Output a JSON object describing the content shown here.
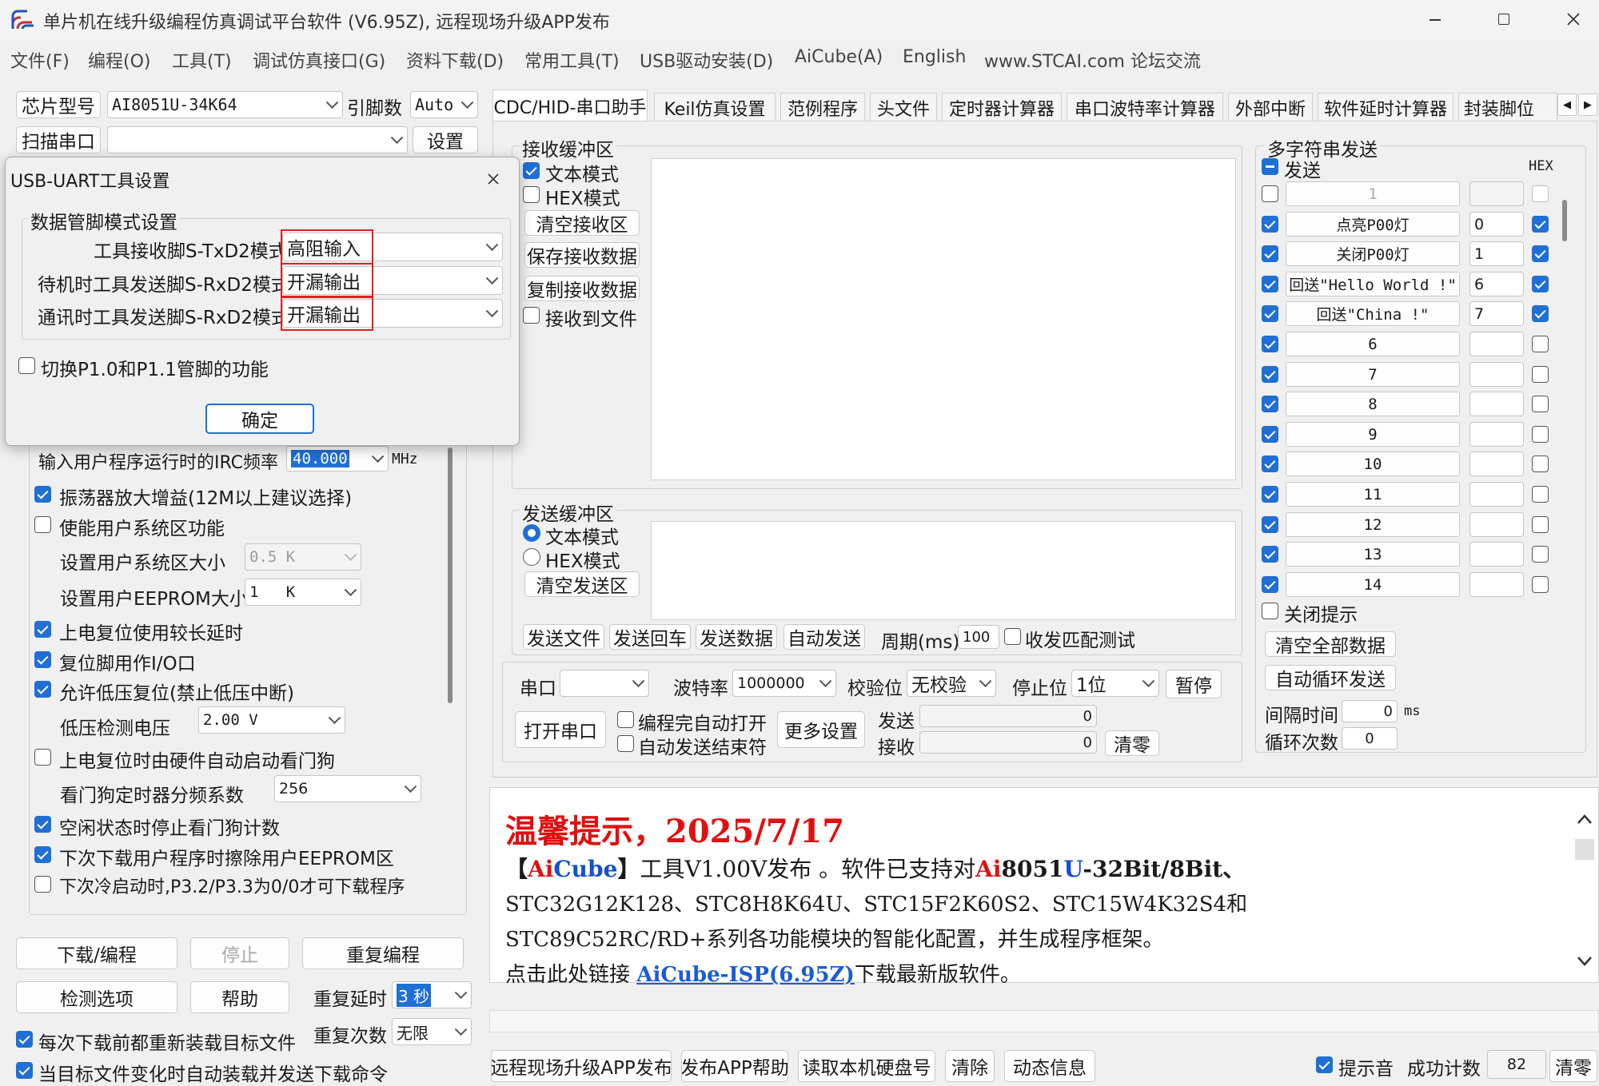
{
  "window": {
    "title": "单片机在线升级编程仿真调试平台软件 (V6.95Z), 远程现场升级APP发布"
  },
  "menu": [
    "文件(F)",
    "编程(O)",
    "工具(T)",
    "调试仿真接口(G)",
    "资料下载(D)",
    "常用工具(T)",
    "USB驱动安装(D)",
    "AiCube(A)",
    "English",
    "www.STCAI.com 论坛交流"
  ],
  "left": {
    "chip_btn": "芯片型号",
    "chip_value": "AI8051U-34K64",
    "pin_label": "引脚数",
    "pin_value": "Auto",
    "scan_btn": "扫描串口",
    "port_value": "",
    "settings_btn": "设置",
    "irc_label": "输入用户程序运行时的IRC频率",
    "irc_value": "40.000",
    "irc_unit": "MHz",
    "options": [
      {
        "label": "振荡器放大增益(12M以上建议选择)",
        "checked": true
      },
      {
        "label": "使能用户系统区功能",
        "checked": false
      },
      {
        "label": "上电复位使用较长延时",
        "checked": true
      },
      {
        "label": "复位脚用作I/O口",
        "checked": true
      },
      {
        "label": "允许低压复位(禁止低压中断)",
        "checked": true
      },
      {
        "label": "上电复位时由硬件自动启动看门狗",
        "checked": false
      },
      {
        "label": "空闲状态时停止看门狗计数",
        "checked": true
      },
      {
        "label": "下次下载用户程序时擦除用户EEPROM区",
        "checked": true
      },
      {
        "label": "下次冷启动时,P3.2/P3.3为0/0才可下载程序",
        "checked": false
      }
    ],
    "sysarea_label": "设置用户系统区大小",
    "sysarea_value": "0.5 K",
    "eeprom_label": "设置用户EEPROM大小",
    "eeprom_value": "1   K",
    "lvd_label": "低压检测电压",
    "lvd_value": "2.00 V",
    "wdt_label": "看门狗定时器分频系数",
    "wdt_value": "256",
    "download_btn": "下载/编程",
    "stop_btn": "停止",
    "reprogram_btn": "重复编程",
    "check_btn": "检测选项",
    "help_btn": "帮助",
    "delay_label": "重复延时",
    "delay_value": "3 秒",
    "count_label": "重复次数",
    "count_value": "无限",
    "reload_label": "每次下载前都重新装载目标文件",
    "autosend_label": "当目标文件变化时自动装载并发送下载命令"
  },
  "dialog": {
    "title": "USB-UART工具设置",
    "group": "数据管脚模式设置",
    "rows": [
      {
        "label": "工具接收脚S-TxD2模式",
        "value": "高阻输入"
      },
      {
        "label": "待机时工具发送脚S-RxD2模式",
        "value": "开漏输出"
      },
      {
        "label": "通讯时工具发送脚S-RxD2模式",
        "value": "开漏输出"
      }
    ],
    "switch_label": "切换P1.0和P1.1管脚的功能",
    "ok": "确定"
  },
  "tabs": [
    "CDC/HID-串口助手",
    "Keil仿真设置",
    "范例程序",
    "头文件",
    "定时器计算器",
    "串口波特率计算器",
    "外部中断",
    "软件延时计算器",
    "封装脚位"
  ],
  "recv": {
    "title": "接收缓冲区",
    "text_mode": "文本模式",
    "hex_mode": "HEX模式",
    "clear": "清空接收区",
    "save": "保存接收数据",
    "copy": "复制接收数据",
    "to_file": "接收到文件"
  },
  "send": {
    "title": "发送缓冲区",
    "text_mode": "文本模式",
    "hex_mode": "HEX模式",
    "clear": "清空发送区",
    "send_file": "发送文件",
    "send_cr": "发送回车",
    "send_data": "发送数据",
    "auto_send": "自动发送",
    "period_label": "周期(ms)",
    "period_value": "100",
    "match_test": "收发匹配测试"
  },
  "serial": {
    "port_label": "串口",
    "port_value": "",
    "baud_label": "波特率",
    "baud_value": "1000000",
    "parity_label": "校验位",
    "parity_value": "无校验",
    "stop_label": "停止位",
    "stop_value": "1位",
    "pause": "暂停",
    "open": "打开串口",
    "auto_open": "编程完自动打开",
    "auto_close": "自动发送结束符",
    "more": "更多设置",
    "sent_label": "发送",
    "sent_value": "0",
    "recv_label": "接收",
    "recv_value": "0",
    "clear": "清零"
  },
  "multi": {
    "title": "多字符串发送",
    "send_label": "发送",
    "hex_label": "HEX",
    "rows": [
      {
        "checked": false,
        "name": "1",
        "value": "",
        "hex": false,
        "blank": true
      },
      {
        "checked": true,
        "name": "点亮P00灯",
        "value": "0",
        "hex": true
      },
      {
        "checked": true,
        "name": "关闭P00灯",
        "value": "1",
        "hex": true
      },
      {
        "checked": true,
        "name": "回送\"Hello World !\"",
        "value": "6",
        "hex": true
      },
      {
        "checked": true,
        "name": "回送\"China !\"",
        "value": "7",
        "hex": true
      },
      {
        "checked": true,
        "name": "6",
        "value": "",
        "hex": false
      },
      {
        "checked": true,
        "name": "7",
        "value": "",
        "hex": false
      },
      {
        "checked": true,
        "name": "8",
        "value": "",
        "hex": false
      },
      {
        "checked": true,
        "name": "9",
        "value": "",
        "hex": false
      },
      {
        "checked": true,
        "name": "10",
        "value": "",
        "hex": false
      },
      {
        "checked": true,
        "name": "11",
        "value": "",
        "hex": false
      },
      {
        "checked": true,
        "name": "12",
        "value": "",
        "hex": false
      },
      {
        "checked": true,
        "name": "13",
        "value": "",
        "hex": false
      },
      {
        "checked": true,
        "name": "14",
        "value": "",
        "hex": false
      }
    ],
    "close_hint": "关闭提示",
    "clear_all": "清空全部数据",
    "auto_loop": "自动循环发送",
    "interval_label": "间隔时间",
    "interval_value": "0",
    "interval_unit": "ms",
    "loop_label": "循环次数",
    "loop_value": "0"
  },
  "notice": {
    "title": "温馨提示，2025/7/17",
    "l1_open": "【",
    "l1_brand_a": "Ai",
    "l1_brand_b": "Cube",
    "l1_close": "】",
    "l1_text": "工具V1.00V发布 。软件已支持对",
    "l1_ai": "Ai",
    "l1_mid": "8051",
    "l1_u": "U",
    "l1_tail": "-32Bit/8Bit、",
    "l2": "STC32G12K128、STC8H8K64U、STC15F2K60S2、STC15W4K32S4和",
    "l3": "STC89C52RC/RD+系列各功能模块的智能化配置，并生成程序框架。",
    "l4_pre": "点击此处链接",
    "l4_link": "AiCube-ISP(6.95Z)",
    "l4_post": "下载最新版软件。"
  },
  "bottom": {
    "remote": "远程现场升级APP发布",
    "app_help": "发布APP帮助",
    "read_disk": "读取本机硬盘号",
    "clear": "清除",
    "dynamic": "动态信息",
    "sound": "提示音",
    "success_label": "成功计数",
    "success_value": "82",
    "clear_count": "清零"
  },
  "colors": {
    "accent": "#1f6fd4",
    "highlight_border": "#e02020",
    "notice_red": "#e01010"
  }
}
